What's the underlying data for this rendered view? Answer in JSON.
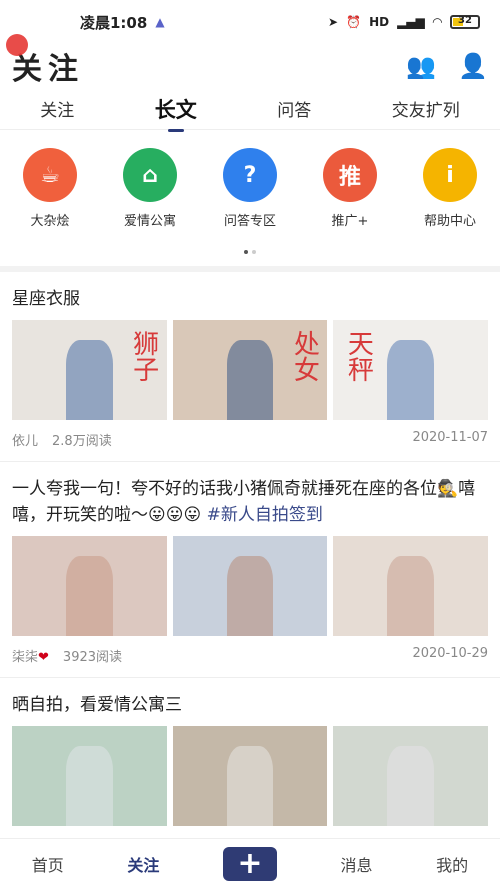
{
  "status": {
    "time": "凌晨1:08",
    "battery": "32",
    "network": "HD"
  },
  "header": {
    "title": "关注"
  },
  "tabs": [
    {
      "label": "关注"
    },
    {
      "label": "长文"
    },
    {
      "label": "问答"
    },
    {
      "label": "交友扩列"
    }
  ],
  "categories": [
    {
      "label": "大杂烩",
      "icon": "cup-icon",
      "color": "#f0603d"
    },
    {
      "label": "爱情公寓",
      "icon": "house-icon",
      "color": "#27ae60"
    },
    {
      "label": "问答专区",
      "icon": "question-icon",
      "color": "#2f80ed"
    },
    {
      "label": "推广+",
      "icon": "promote-icon",
      "color": "#eb5a3c",
      "glyph": "推"
    },
    {
      "label": "帮助中心",
      "icon": "info-icon",
      "color": "#f5b400",
      "glyph": "i"
    }
  ],
  "posts": [
    {
      "title": "星座衣服",
      "author": "依儿",
      "reads": "2.8万阅读",
      "date": "2020-11-07",
      "overlays": [
        "狮子",
        "处女",
        "天秤"
      ]
    },
    {
      "title": "一人夸我一句！夸不好的话我小猪佩奇就捶死在座的各位🕵️嘻嘻，开玩笑的啦～😛😛😛",
      "tag": "#新人自拍签到",
      "author": "柒柒",
      "reads": "3923阅读",
      "date": "2020-10-29"
    },
    {
      "title": "晒自拍，看爱情公寓三"
    }
  ],
  "nav": {
    "home": "首页",
    "follow": "关注",
    "plus": "+",
    "messages": "消息",
    "mine": "我的"
  },
  "colors": {
    "accent": "#2f3b74"
  }
}
